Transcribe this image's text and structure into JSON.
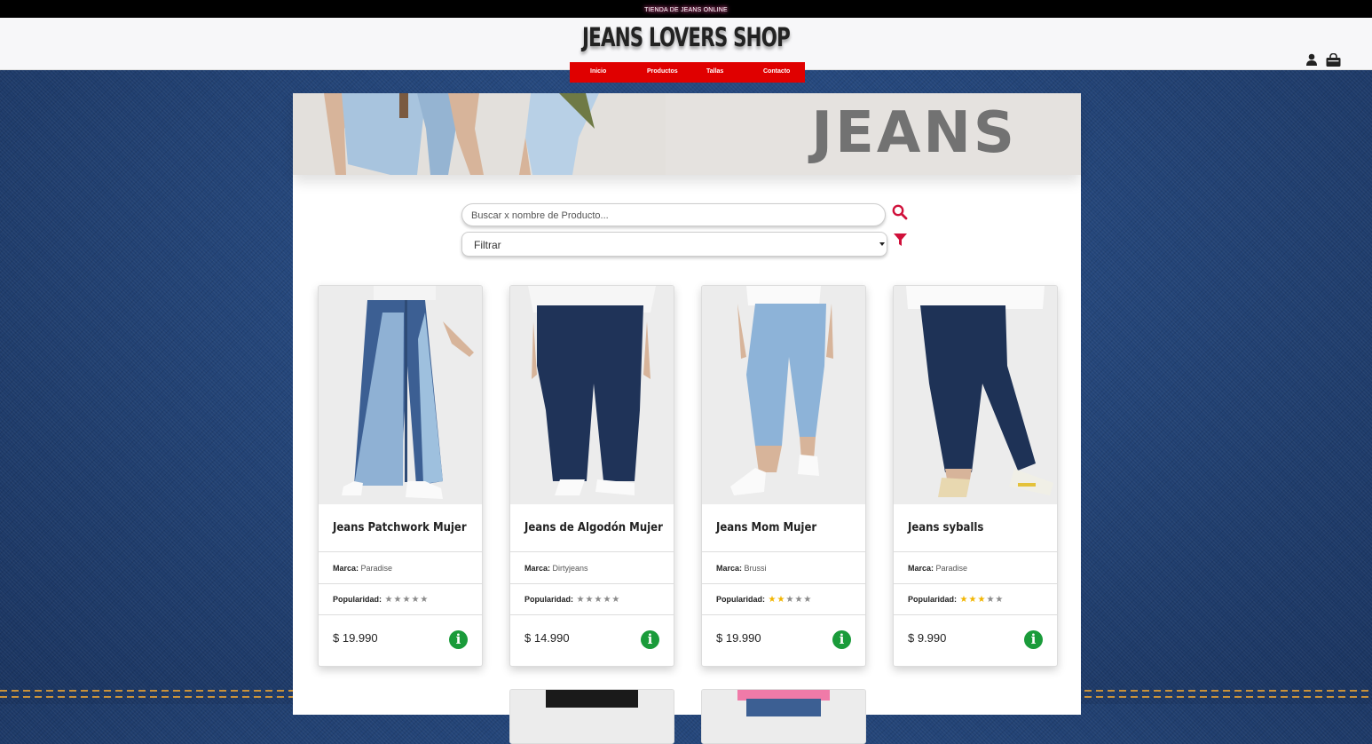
{
  "topbar": {
    "tagline": "TIENDA DE JEANS ONLINE"
  },
  "header": {
    "brand": "JEANS LOVERS SHOP",
    "nav": [
      "Inicio",
      "Productos",
      "Tallas",
      "Contacto"
    ]
  },
  "hero": {
    "title": "JEANS"
  },
  "search": {
    "placeholder": "Buscar x nombre de Producto..."
  },
  "filter": {
    "selected": "Filtrar"
  },
  "labels": {
    "brand": "Marca:",
    "popularity": "Popularidad:"
  },
  "products": [
    {
      "name": "Jeans Patchwork Mujer",
      "brand": "Paradise",
      "rating": 0,
      "price": "$ 19.990"
    },
    {
      "name": "Jeans de Algodón Mujer",
      "brand": "Dirtyjeans",
      "rating": 0,
      "price": "$ 14.990"
    },
    {
      "name": "Jeans Mom Mujer",
      "brand": "Brussi",
      "rating": 2,
      "price": "$ 19.990"
    },
    {
      "name": "Jeans syballs",
      "brand": "Paradise",
      "rating": 3,
      "price": "$ 9.990"
    }
  ],
  "colors": {
    "nav": "#e00000",
    "accent": "#d0103a",
    "info": "#1a9b3a",
    "star": "#f2b500"
  },
  "icons": {
    "search": "search-icon",
    "filter": "filter-icon",
    "user": "user-icon",
    "cart": "shopping-bag-icon",
    "info": "info-icon",
    "star": "star-icon"
  }
}
